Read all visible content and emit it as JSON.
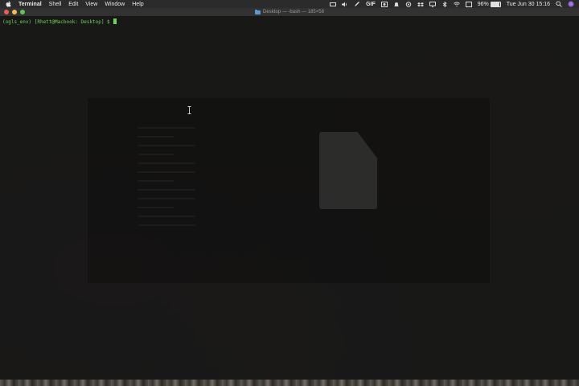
{
  "menubar": {
    "app_name": "Terminal",
    "items": [
      "Shell",
      "Edit",
      "View",
      "Window",
      "Help"
    ],
    "status": {
      "gif_label": "GIF",
      "battery_percent": 96,
      "battery_text": "96%",
      "datetime": "Tue Jun 30  15:16"
    }
  },
  "window": {
    "title": "Desktop — -bash — 185×58"
  },
  "terminal": {
    "prompt": "(ogls_env) [Rhett@Macbook: Desktop] $ "
  },
  "colors": {
    "prompt_green": "#6fd25a",
    "close": "#ee5b53",
    "minimize": "#f4bd4f",
    "maximize": "#5fc454"
  },
  "icons": [
    "apple-icon",
    "gif-icon",
    "battery-icon",
    "wifi-icon",
    "search-icon",
    "siri-icon",
    "folder-icon",
    "document-icon",
    "text-cursor-icon"
  ]
}
